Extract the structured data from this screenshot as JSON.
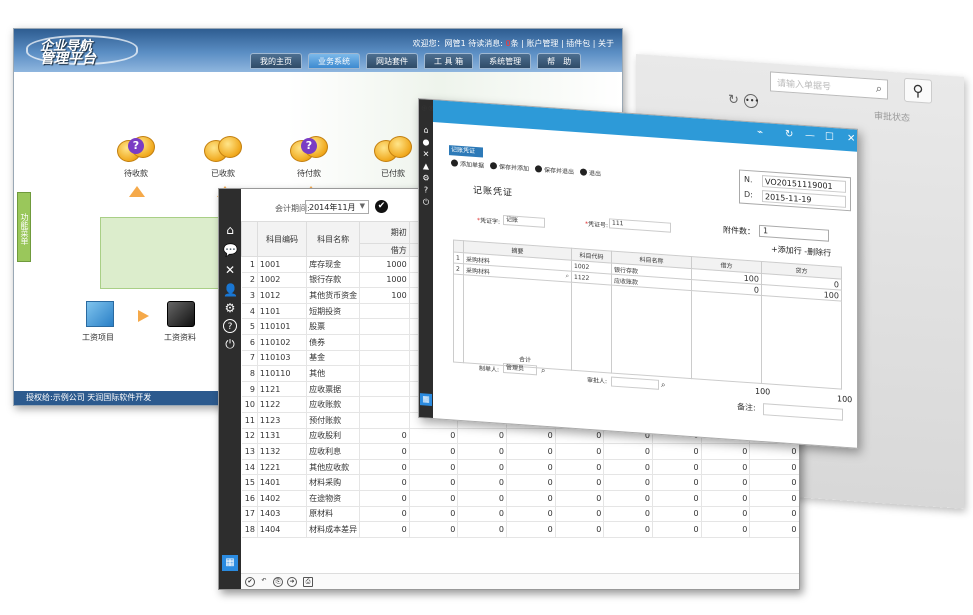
{
  "portal": {
    "logo_line1": "企业导航",
    "logo_line2": "管理平台",
    "welcome": "欢迎您：网管1 待读消息: ",
    "msg_count": "0",
    "msg_unit": "条",
    "links": "| 账户管理 | 插件包 | 关于",
    "tabs": [
      "我的主页",
      "业务系统",
      "网站套件",
      "工 具 箱",
      "系统管理",
      "帮　助"
    ],
    "active_tab": 1,
    "side_tab": "功能菜单",
    "icons": [
      "待收款",
      "已收款",
      "待付款",
      "已付款"
    ],
    "lower_icons": [
      "工资项目",
      "工资资料"
    ],
    "footer": "授权给:示例公司  天润国际软件开发"
  },
  "back_window": {
    "search_placeholder": "请输入单据号",
    "status_label": "审批状态"
  },
  "ledger": {
    "period_label": "会计期间:",
    "period_value": "2014年11月",
    "headers": {
      "code": "科目编码",
      "name": "科目名称",
      "period": "期初",
      "debit": "借方"
    },
    "rows": [
      {
        "no": "1",
        "code": "1001",
        "name": "库存现金",
        "v": "1000"
      },
      {
        "no": "2",
        "code": "1002",
        "name": "银行存款",
        "v": "1000"
      },
      {
        "no": "3",
        "code": "1012",
        "name": "其他货币资金",
        "v": "100"
      },
      {
        "no": "4",
        "code": "1101",
        "name": "短期投资",
        "v": ""
      },
      {
        "no": "5",
        "code": "110101",
        "name": "股票",
        "v": ""
      },
      {
        "no": "6",
        "code": "110102",
        "name": "债券",
        "v": ""
      },
      {
        "no": "7",
        "code": "110103",
        "name": "基金",
        "v": ""
      },
      {
        "no": "8",
        "code": "110110",
        "name": "其他",
        "v": ""
      },
      {
        "no": "9",
        "code": "1121",
        "name": "应收票据",
        "v": ""
      },
      {
        "no": "10",
        "code": "1122",
        "name": "应收账款",
        "v": ""
      },
      {
        "no": "11",
        "code": "1123",
        "name": "预付账款",
        "v": ""
      },
      {
        "no": "12",
        "code": "1131",
        "name": "应收股利",
        "v": "0"
      },
      {
        "no": "13",
        "code": "1132",
        "name": "应收利息",
        "v": "0"
      },
      {
        "no": "14",
        "code": "1221",
        "name": "其他应收款",
        "v": "0"
      },
      {
        "no": "15",
        "code": "1401",
        "name": "材料采购",
        "v": "0"
      },
      {
        "no": "16",
        "code": "1402",
        "name": "在途物资",
        "v": "0"
      },
      {
        "no": "17",
        "code": "1403",
        "name": "原材料",
        "v": "0"
      },
      {
        "no": "18",
        "code": "1404",
        "name": "材料成本差异",
        "v": "0"
      }
    ],
    "zero": "0"
  },
  "voucher": {
    "window_title": "记账凭证",
    "toolbar": [
      "添加单据",
      "保存并添加",
      "保存并退出",
      "退出"
    ],
    "no_label": "N.",
    "no_value": "VO20151119001",
    "date_label": "D:",
    "date_value": "2015-11-19",
    "title": "记账凭证",
    "type_label": "凭证字:",
    "type_value": "记账",
    "number_label": "凭证号:",
    "number_value": "111",
    "attach_label": "附件数：",
    "attach_value": "1",
    "add_row": "+添加行",
    "del_row": "-删除行",
    "cols": [
      "摘要",
      "科目代码",
      "科目名称",
      "借方",
      "贷方"
    ],
    "lines": [
      {
        "no": "1",
        "summary": "采购材料",
        "code": "1002",
        "name": "银行存款",
        "debit": "100",
        "credit": "0"
      },
      {
        "no": "2",
        "summary": "采购材料",
        "code": "1122",
        "name": "应收账款",
        "debit": "0",
        "credit": "100"
      }
    ],
    "total_label": "合计",
    "total_debit": "100",
    "total_credit": "100",
    "maker_label": "制单人:",
    "maker_value": "管理员",
    "approver_label": "审批人:",
    "remark_label": "备注:"
  }
}
